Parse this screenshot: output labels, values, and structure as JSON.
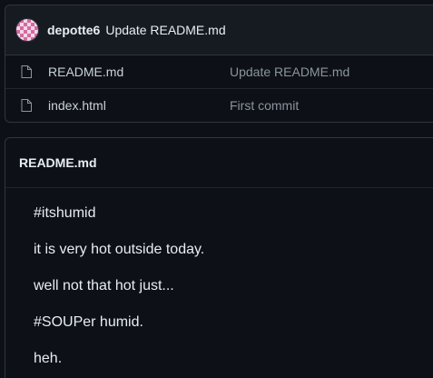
{
  "commit": {
    "author": "depotte6",
    "message": "Update README.md"
  },
  "files": [
    {
      "name": "README.md",
      "last_commit": "Update README.md",
      "icon": "file-icon"
    },
    {
      "name": "index.html",
      "last_commit": "First commit",
      "icon": "file-icon"
    }
  ],
  "readme": {
    "title": "README.md",
    "paragraphs": [
      "#itshumid",
      "it is very hot outside today.",
      "well not that hot just...",
      "#SOUPer humid.",
      "heh."
    ]
  }
}
